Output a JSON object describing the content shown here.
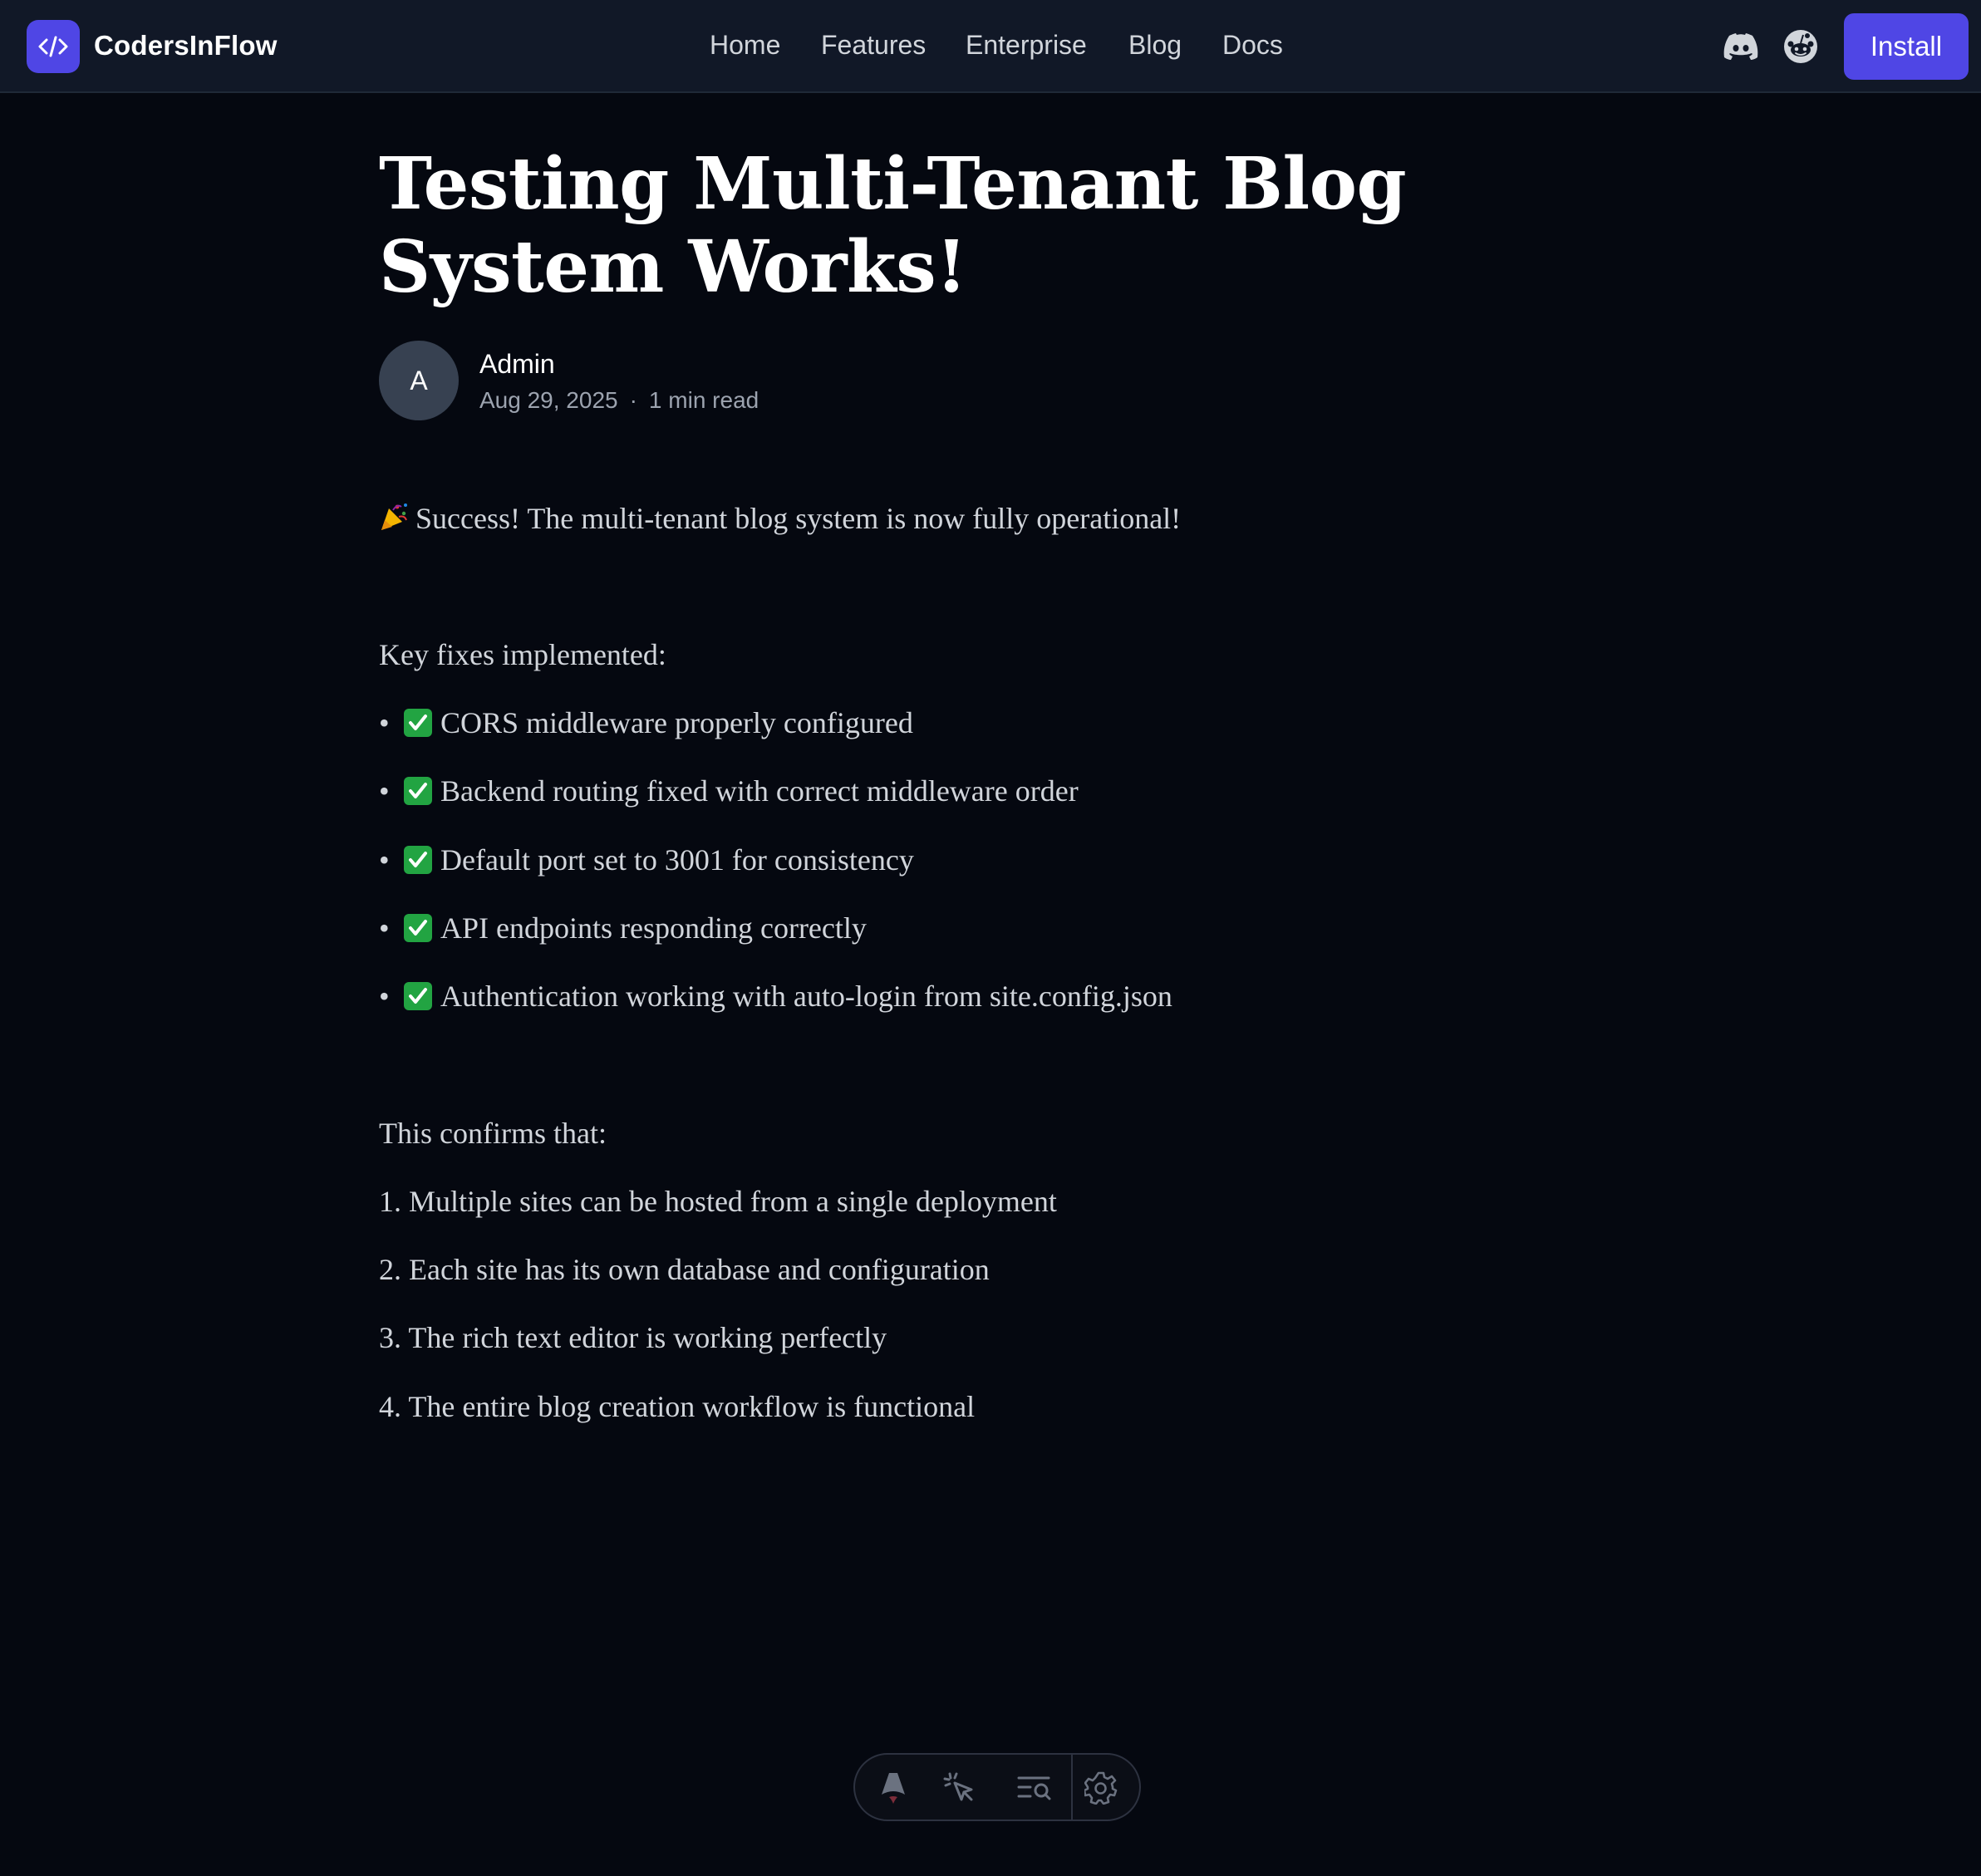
{
  "header": {
    "brand": "CodersInFlow",
    "nav": [
      {
        "label": "Home"
      },
      {
        "label": "Features"
      },
      {
        "label": "Enterprise"
      },
      {
        "label": "Blog"
      },
      {
        "label": "Docs"
      }
    ],
    "icons": [
      "discord-icon",
      "reddit-icon"
    ],
    "install_label": "Install",
    "accent": "#4f46e5"
  },
  "post": {
    "title": "Testing Multi-Tenant Blog System Works!",
    "author_initial": "A",
    "author": "Admin",
    "date": "Aug 29, 2025",
    "read_time": "1 min read",
    "intro": "Success! The multi-tenant blog system is now fully operational!",
    "fixes_heading": "Key fixes implemented:",
    "fixes": [
      "CORS middleware properly configured",
      "Backend routing fixed with correct middleware order",
      "Default port set to 3001 for consistency",
      "API endpoints responding correctly",
      "Authentication working with auto-login from site.config.json"
    ],
    "confirms_heading": "This confirms that:",
    "confirms": [
      "1. Multiple sites can be hosted from a single deployment",
      "2. Each site has its own database and configuration",
      "3. The rich text editor is working perfectly",
      "4. The entire blog creation workflow is functional"
    ]
  },
  "toolbar": {
    "icons": [
      "astro-icon",
      "inspect-cursor-icon",
      "audit-icon",
      "settings-icon"
    ]
  }
}
